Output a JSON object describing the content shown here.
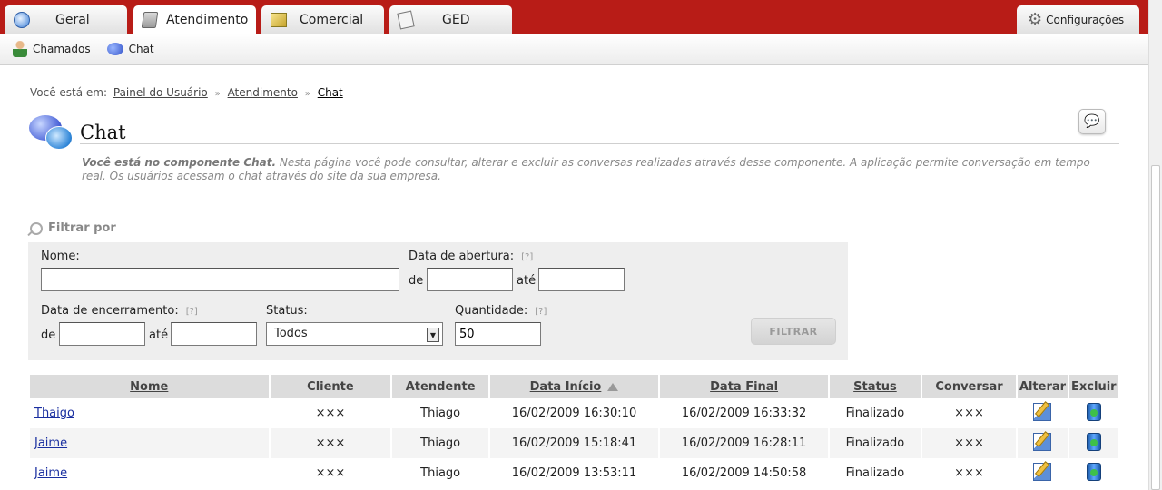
{
  "tabs": [
    {
      "label": "Geral",
      "icon": "globe-icon"
    },
    {
      "label": "Atendimento",
      "icon": "phone-icon",
      "active": true
    },
    {
      "label": "Comercial",
      "icon": "chart-icon"
    },
    {
      "label": "GED",
      "icon": "document-icon"
    }
  ],
  "config_label": "Configurações",
  "subnav": [
    {
      "label": "Chamados",
      "icon": "person-icon"
    },
    {
      "label": "Chat",
      "icon": "chat-bubbles-icon"
    }
  ],
  "breadcrumb": {
    "prefix": "Você está em:",
    "items": [
      "Painel do Usuário",
      "Atendimento",
      "Chat"
    ],
    "separator": "»"
  },
  "page": {
    "title": "Chat",
    "description_bold": "Você está no componente Chat.",
    "description_rest": " Nesta página você pode consultar, alterar e excluir as conversas realizadas através desse componente. A aplicação permite conversação em tempo real. Os usuários acessam o chat através do site da sua empresa."
  },
  "filter": {
    "title": "Filtrar por",
    "nome_label": "Nome:",
    "nome_value": "",
    "abertura_label": "Data de abertura:",
    "help": "[?]",
    "de": "de",
    "ate": "até",
    "encerramento_label": "Data de encerramento:",
    "status_label": "Status:",
    "status_value": "Todos",
    "quantidade_label": "Quantidade:",
    "quantidade_value": "50",
    "button": "FILTRAR"
  },
  "table": {
    "headers": [
      "Nome",
      "Cliente",
      "Atendente",
      "Data Início",
      "Data Final",
      "Status",
      "Conversar",
      "Alterar",
      "Excluir"
    ],
    "rows": [
      {
        "nome": "Thaigo",
        "cliente": "×××",
        "atendente": "Thiago",
        "inicio": "16/02/2009 16:30:10",
        "final": "16/02/2009 16:33:32",
        "status": "Finalizado",
        "conversar": "×××"
      },
      {
        "nome": "Jaime",
        "cliente": "×××",
        "atendente": "Thiago",
        "inicio": "16/02/2009 15:18:41",
        "final": "16/02/2009 16:28:11",
        "status": "Finalizado",
        "conversar": "×××"
      },
      {
        "nome": "Jaime",
        "cliente": "×××",
        "atendente": "Thiago",
        "inicio": "16/02/2009 13:53:11",
        "final": "16/02/2009 14:50:58",
        "status": "Finalizado",
        "conversar": "×××"
      }
    ]
  },
  "colors": {
    "topbar": "#b81c17",
    "link": "#1a2fa0"
  }
}
